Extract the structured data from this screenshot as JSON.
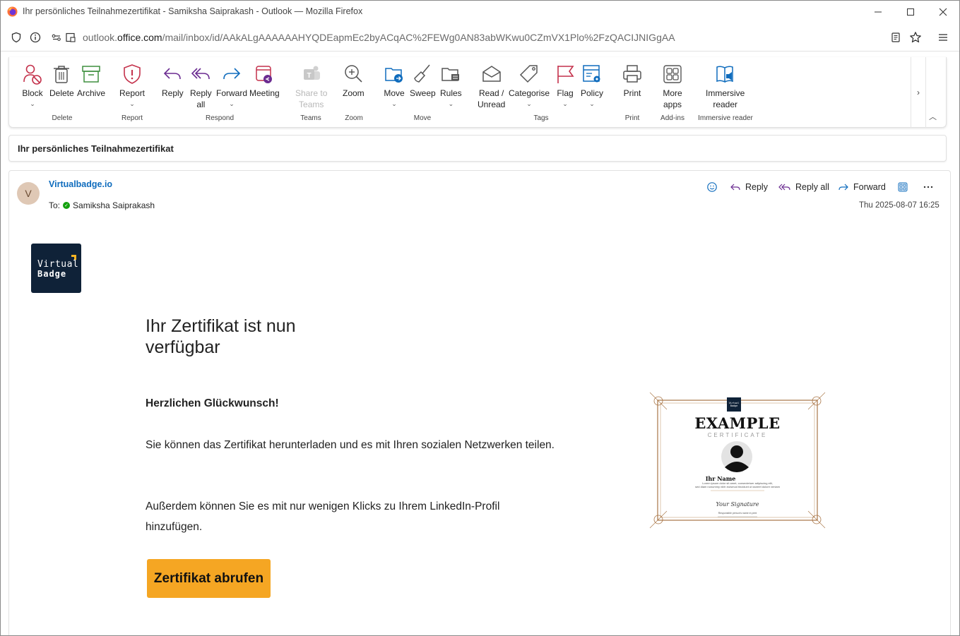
{
  "window": {
    "title": "Ihr persönliches Teilnahmezertifikat - Samiksha Saiprakash - Outlook — Mozilla Firefox"
  },
  "urlbar": {
    "url_prefix": "outlook.",
    "url_domain": "office.com",
    "url_path": "/mail/inbox/id/AAkALgAAAAAAHYQDEapmEc2byACqAC%2FEWg0AN83abWKwu0CZmVX1Plo%2FzQACIJNIGgAA"
  },
  "ribbon": {
    "buttons": {
      "block": "Block",
      "delete": "Delete",
      "archive": "Archive",
      "report": "Report",
      "reply": "Reply",
      "reply_all_1": "Reply",
      "reply_all_2": "all",
      "forward": "Forward",
      "meeting": "Meeting",
      "share_teams_1": "Share to",
      "share_teams_2": "Teams",
      "zoom": "Zoom",
      "move": "Move",
      "sweep": "Sweep",
      "rules": "Rules",
      "read_unread_1": "Read /",
      "read_unread_2": "Unread",
      "categorise": "Categorise",
      "flag": "Flag",
      "policy": "Policy",
      "print": "Print",
      "more_apps_1": "More",
      "more_apps_2": "apps",
      "immersive_1": "Immersive",
      "immersive_2": "reader"
    },
    "groups": {
      "delete": "Delete",
      "report": "Report",
      "respond": "Respond",
      "teams": "Teams",
      "zoom": "Zoom",
      "move": "Move",
      "tags": "Tags",
      "print": "Print",
      "addins": "Add-ins",
      "immersive": "Immersive reader"
    }
  },
  "message": {
    "subject": "Ihr persönliches Teilnahmezertifikat",
    "avatar_initial": "V",
    "sender": "Virtualbadge.io",
    "to_label": "To:",
    "to_name": "Samiksha Saiprakash",
    "actions": {
      "reply": "Reply",
      "reply_all": "Reply all",
      "forward": "Forward"
    },
    "date": "Thu 2025-08-07 16:25"
  },
  "email_body": {
    "logo_line1": "Virtual",
    "logo_line2": "Badge",
    "headline": "Ihr Zertifikat ist nun verfügbar",
    "congrats": "Herzlichen Glückwunsch!",
    "paragraph1": "Sie können das Zertifikat herunterladen und es mit Ihren sozialen Netzwerken teilen.",
    "paragraph2": "Außerdem können Sie es mit nur wenigen Klicks zu Ihrem LinkedIn-Profil hinzufügen.",
    "cta": "Zertifikat abrufen"
  },
  "certificate": {
    "title": "EXAMPLE",
    "subtitle": "CERTIFICATE",
    "name": "Ihr Name",
    "lorem1": "Lorem ipsum dolor sit amet, consectetuer adipiscing elit,",
    "lorem2": "sed diam nonummy nibh euismod tincidunt ut laoreet dolore veniam",
    "signature": "Your Signature",
    "signer": "Responsible person's name in print",
    "mini_logo_1": "Virtual",
    "mini_logo_2": "Badge"
  },
  "colors": {
    "accent_blue": "#0f6cbd",
    "cta_orange": "#f5a623",
    "logo_navy": "#0f2238",
    "icon_red": "#c4314b",
    "icon_purple": "#6b2c91"
  }
}
